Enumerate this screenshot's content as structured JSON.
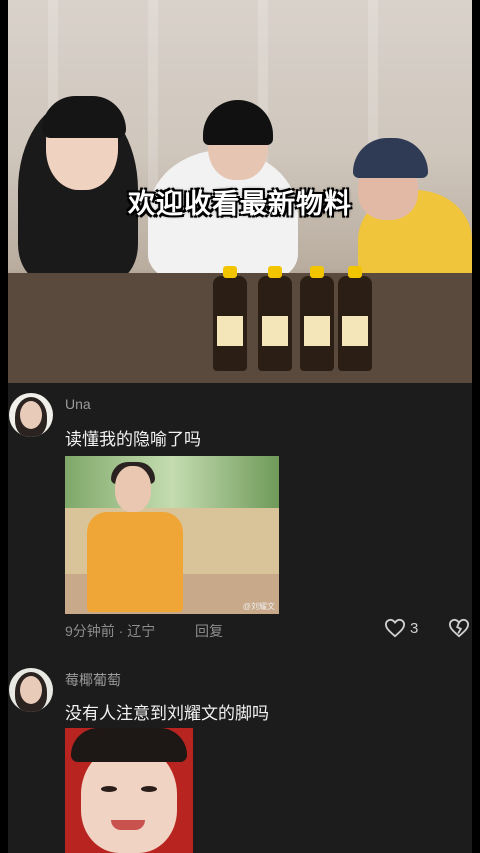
{
  "video": {
    "caption": "欢迎收看最新物料"
  },
  "comments": [
    {
      "username": "Una",
      "text": "读懂我的隐喻了吗",
      "image_watermark": "@刘耀文",
      "time": "9分钟前",
      "location": "辽宁",
      "reply_label": "回复",
      "likes": "3"
    },
    {
      "username": "莓椰葡萄",
      "text": "没有人注意到刘耀文的脚吗"
    }
  ],
  "icons": {
    "like": "heart-outline-icon",
    "dislike": "broken-heart-icon"
  },
  "colors": {
    "panel_bg": "#1c1c1c",
    "muted_text": "#8d8d8d"
  }
}
